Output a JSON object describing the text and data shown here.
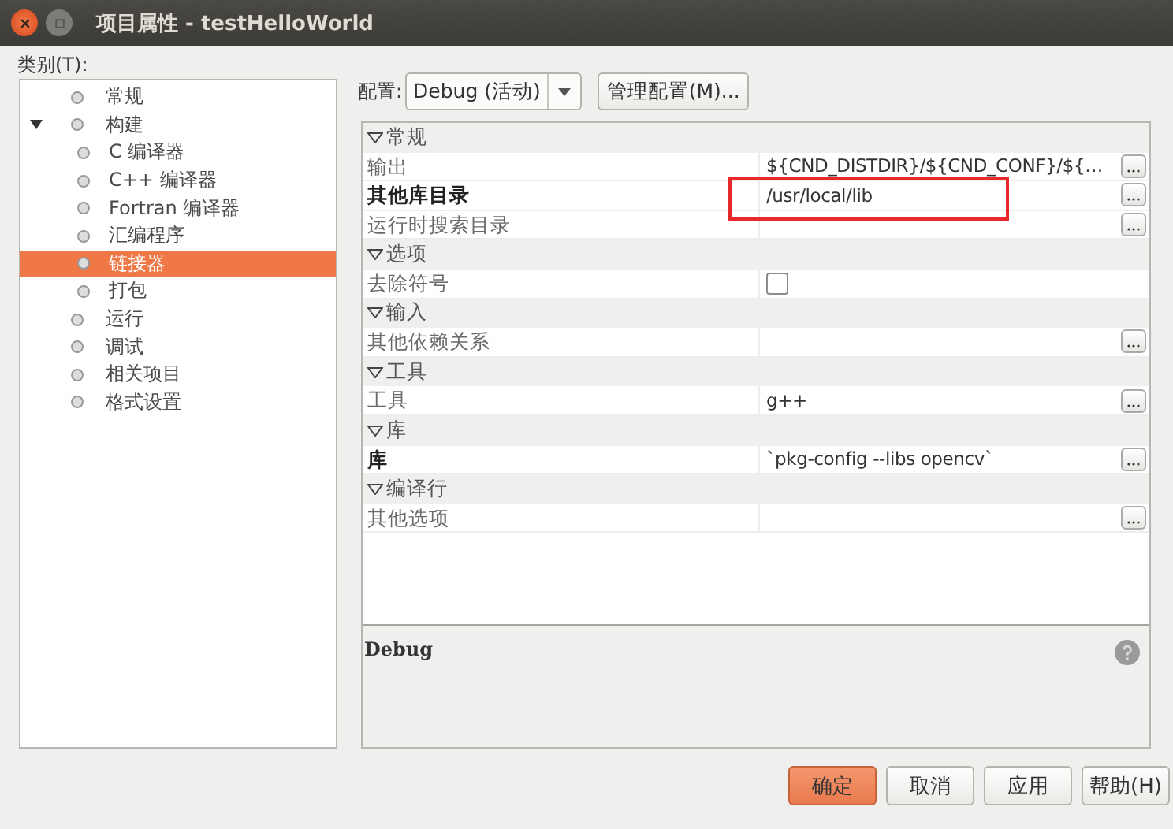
{
  "window": {
    "title": "项目属性 - testHelloWorld"
  },
  "categories": {
    "label": "类别(T):",
    "items": [
      {
        "label": "常规",
        "selected": false
      },
      {
        "label": "构建",
        "selected": false,
        "expanded": true,
        "children": [
          {
            "label": "C 编译器",
            "selected": false
          },
          {
            "label": "C++ 编译器",
            "selected": false
          },
          {
            "label": "Fortran 编译器",
            "selected": false
          },
          {
            "label": "汇编程序",
            "selected": false
          },
          {
            "label": "链接器",
            "selected": true
          },
          {
            "label": "打包",
            "selected": false
          }
        ]
      },
      {
        "label": "运行",
        "selected": false
      },
      {
        "label": "调试",
        "selected": false
      },
      {
        "label": "相关项目",
        "selected": false
      },
      {
        "label": "格式设置",
        "selected": false
      }
    ]
  },
  "configuration": {
    "label": "配置:",
    "value": "Debug (活动)",
    "manage_button": "管理配置(M)..."
  },
  "properties": [
    {
      "section": "常规",
      "rows": [
        {
          "kind": "text",
          "name": "输出",
          "value": "${CND_DISTDIR}/${CND_CONF}/${…",
          "modified": false
        },
        {
          "kind": "text",
          "name": "其他库目录",
          "value": "/usr/local/lib",
          "modified": true
        },
        {
          "kind": "text",
          "name": "运行时搜索目录",
          "modified": false
        }
      ]
    },
    {
      "section": "选项",
      "rows": [
        {
          "kind": "checkbox",
          "name": "去除符号",
          "checked": false,
          "modified": false
        }
      ]
    },
    {
      "section": "输入",
      "rows": [
        {
          "kind": "text",
          "name": "其他依赖关系",
          "modified": false
        }
      ]
    },
    {
      "section": "工具",
      "rows": [
        {
          "kind": "text",
          "name": "工具",
          "value": "g++",
          "modified": false
        }
      ]
    },
    {
      "section": "库",
      "rows": [
        {
          "kind": "text",
          "name": "库",
          "value": "`pkg-config --libs opencv`",
          "modified": true
        }
      ]
    },
    {
      "section": "编译行",
      "rows": [
        {
          "kind": "text",
          "name": "其他选项",
          "modified": false
        }
      ]
    }
  ],
  "description": {
    "text": "Debug"
  },
  "buttons": [
    {
      "label": "确定",
      "default": true
    },
    {
      "label": "取消",
      "default": false
    },
    {
      "label": "应用",
      "default": false
    },
    {
      "label": "帮助(H)",
      "default": false
    }
  ]
}
